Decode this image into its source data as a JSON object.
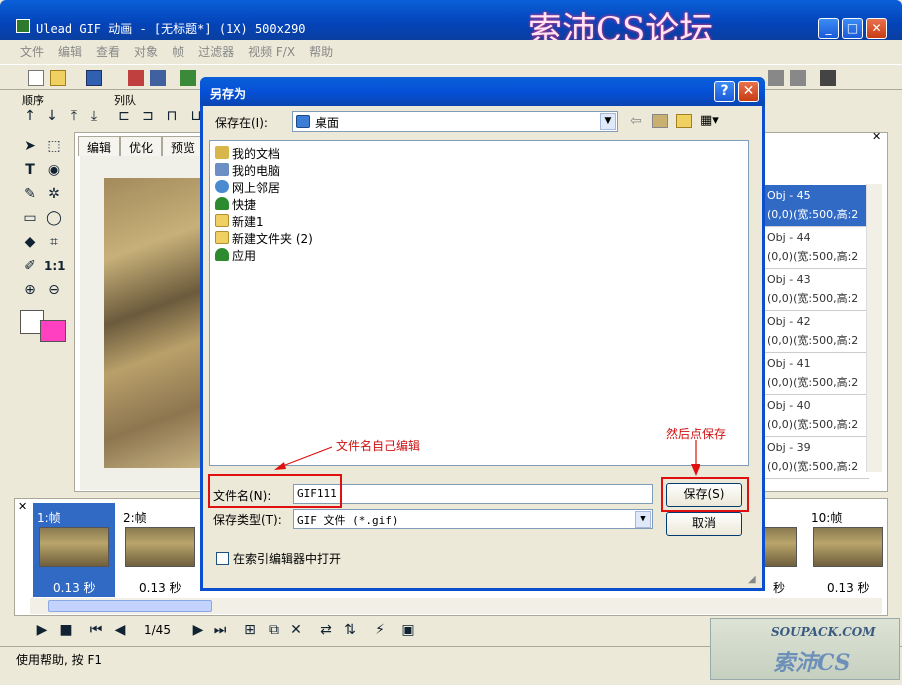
{
  "app": {
    "title": "Ulead GIF 动画 - [无标题*] (1X) 500x290",
    "watermark": "索沛CS论坛",
    "minimize": "_",
    "maximize": "□",
    "close": "✕"
  },
  "menu": [
    "文件",
    "编辑",
    "查看",
    "对象",
    "帧",
    "过滤器",
    "视频 F/X",
    "帮助"
  ],
  "sections": {
    "order": "顺序",
    "queue": "列队"
  },
  "tabs": [
    "编辑",
    "优化",
    "预览"
  ],
  "objects": [
    {
      "name": "Obj - 45",
      "info": "(0,0)(宽:500,高:2",
      "selected": true
    },
    {
      "name": "Obj - 44",
      "info": "(0,0)(宽:500,高:2",
      "selected": false
    },
    {
      "name": "Obj - 43",
      "info": "(0,0)(宽:500,高:2",
      "selected": false
    },
    {
      "name": "Obj - 42",
      "info": "(0,0)(宽:500,高:2",
      "selected": false
    },
    {
      "name": "Obj - 41",
      "info": "(0,0)(宽:500,高:2",
      "selected": false
    },
    {
      "name": "Obj - 40",
      "info": "(0,0)(宽:500,高:2",
      "selected": false
    },
    {
      "name": "Obj - 39",
      "info": "(0,0)(宽:500,高:2",
      "selected": false
    }
  ],
  "frames": [
    {
      "label": "1:帧",
      "time": "0.13 秒",
      "selected": true
    },
    {
      "label": "2:帧",
      "time": "0.13 秒",
      "selected": false
    },
    {
      "label": "10:帧",
      "time": "0.13 秒",
      "selected": false
    }
  ],
  "partial_frame_time": "秒",
  "playback": {
    "counter": "1/45"
  },
  "status": "使用帮助, 按 F1",
  "logo": {
    "url_text": "SOUPACK.COM",
    "brand": "索沛CS"
  },
  "dialog": {
    "title": "另存为",
    "help_button": "?",
    "close_button": "✕",
    "save_in_label": "保存在(I):",
    "save_in_value": "桌面",
    "files": [
      {
        "name": "我的文档",
        "icon": "my-documents-icon",
        "color": "#d9b64a"
      },
      {
        "name": "我的电脑",
        "icon": "my-computer-icon",
        "color": "#6b8fc4"
      },
      {
        "name": "网上邻居",
        "icon": "network-icon",
        "color": "#4a8ad0"
      },
      {
        "name": "快捷",
        "icon": "tree-icon",
        "color": "#2e8a2e"
      },
      {
        "name": "新建1",
        "icon": "folder-icon",
        "color": "#f0d060"
      },
      {
        "name": "新建文件夹 (2)",
        "icon": "folder-icon",
        "color": "#f0d060"
      },
      {
        "name": "应用",
        "icon": "tree-icon",
        "color": "#2e8a2e"
      }
    ],
    "filename_label": "文件名(N):",
    "filename_value": "GIF111",
    "filetype_label": "保存类型(T):",
    "filetype_value": "GIF 文件 (*.gif)",
    "save_button": "保存(S)",
    "cancel_button": "取消",
    "index_checkbox_label": "在索引编辑器中打开",
    "index_checkbox_checked": false
  },
  "annotations": {
    "filename_note": "文件名自己编辑",
    "save_note": "然后点保存"
  }
}
